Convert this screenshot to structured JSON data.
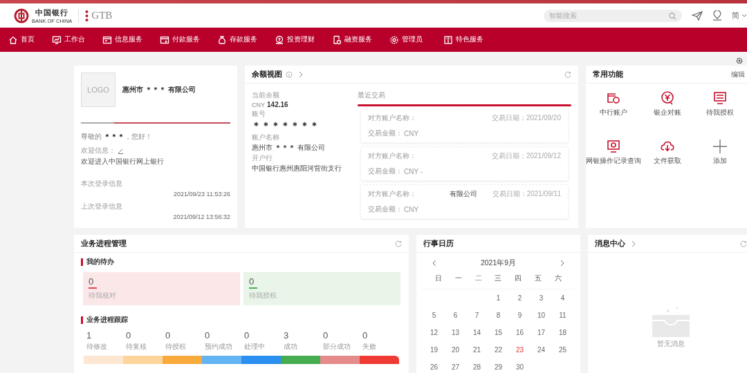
{
  "header": {
    "bank_name": "中国银行",
    "bank_name_en": "BANK OF CHINA",
    "product": "GTB",
    "search": {
      "placeholder": "智能搜索"
    },
    "language": "简"
  },
  "nav": [
    {
      "label": "首页"
    },
    {
      "label": "工作台"
    },
    {
      "label": "信息服务"
    },
    {
      "label": "付款服务"
    },
    {
      "label": "存款服务"
    },
    {
      "label": "投资理财"
    },
    {
      "label": "融资服务"
    },
    {
      "label": "管理员"
    },
    {
      "label": "特色服务"
    }
  ],
  "profile": {
    "logo": "LOGO",
    "company": "惠州市 ＊＊＊ 有限公司",
    "greeting": "尊敬的 **＊＊＊**，您好！",
    "welcome_label": "欢迎信息：",
    "welcome_text": "欢迎进入中国银行网上银行",
    "this_login_label": "本次登录信息",
    "this_login": "2021/09/23 11:53:26",
    "last_login_label": "上次登录信息",
    "last_login": "2021/09/12 13:56:32"
  },
  "balance": {
    "title": "余额视图",
    "current_label": "当前余额",
    "currency": "CNY",
    "amount": "142.16",
    "account_label": "账号",
    "account": "＊＊＊＊＊＊＊",
    "name_label": "账户名称",
    "name": "惠州市 **＊＊＊** 有限公司",
    "bank_label": "开户行",
    "bank": "中国银行惠州惠阳河背街支行",
    "recent_label": "最近交易",
    "transactions": [
      {
        "party_label": "对方账户名称：",
        "amount_label": "交易金额：",
        "amount": "CNY",
        "date": "交易日期：2021/09/20"
      },
      {
        "party_label": "对方账户名称：",
        "amount_label": "交易金额：",
        "amount": "CNY -",
        "date": "交易日期：2021/09/12"
      },
      {
        "party_label": "对方账户名称：",
        "party": "有限公司",
        "amount_label": "交易金额：",
        "amount": "CNY",
        "date": "交易日期：2021/09/11"
      }
    ]
  },
  "shortcuts": {
    "title": "常用功能",
    "edit": "编辑",
    "items": [
      {
        "label": "中行账户"
      },
      {
        "label": "银企对账"
      },
      {
        "label": "待我授权"
      },
      {
        "label": "网银操作记录查询"
      },
      {
        "label": "文件获取"
      },
      {
        "label": "添加"
      }
    ]
  },
  "process": {
    "title": "业务进程管理",
    "todo_title": "我的待办",
    "todos": [
      {
        "count": "0",
        "label": "待我核对",
        "color": "#e0454f"
      },
      {
        "count": "0",
        "label": "待我授权",
        "color": "#4caf50"
      }
    ],
    "tracking_title": "业务进程跟踪",
    "stats": [
      {
        "count": "1",
        "label": "待修改",
        "color": "#fde7d2"
      },
      {
        "count": "0",
        "label": "待复核",
        "color": "#fdd59a"
      },
      {
        "count": "0",
        "label": "待授权",
        "color": "#f9aa3c"
      },
      {
        "count": "0",
        "label": "预约成功",
        "color": "#62b4f3"
      },
      {
        "count": "0",
        "label": "处理中",
        "color": "#2b8ff0"
      },
      {
        "count": "3",
        "label": "成功",
        "color": "#45ad4f"
      },
      {
        "count": "0",
        "label": "部分成功",
        "color": "#e58b8b"
      },
      {
        "count": "0",
        "label": "失败",
        "color": "#ef3b33"
      }
    ]
  },
  "calendar": {
    "title": "行事日历",
    "month": "2021年9月",
    "weekdays": [
      "日",
      "一",
      "二",
      "三",
      "四",
      "五",
      "六"
    ],
    "weeks": [
      [
        {
          "day": "1",
          "selected": false
        },
        {
          "day": "2",
          "selected": false
        },
        {
          "day": "3",
          "selected": false
        },
        {
          "day": "4",
          "selected": false
        }
      ],
      [
        {
          "day": "5",
          "selected": false
        },
        {
          "day": "6",
          "selected": false
        },
        {
          "day": "7",
          "selected": false
        },
        {
          "day": "8",
          "selected": false
        },
        {
          "day": "9",
          "selected": false
        },
        {
          "day": "10",
          "selected": false
        },
        {
          "day": "11",
          "selected": false
        }
      ],
      [
        {
          "day": "12",
          "selected": false
        },
        {
          "day": "13",
          "selected": false
        },
        {
          "day": "14",
          "selected": false
        },
        {
          "day": "15",
          "selected": false
        },
        {
          "day": "16",
          "selected": false
        },
        {
          "day": "17",
          "selected": false
        },
        {
          "day": "18",
          "selected": false
        }
      ],
      [
        {
          "day": "19",
          "selected": false
        },
        {
          "day": "20",
          "selected": false
        },
        {
          "day": "21",
          "selected": false
        },
        {
          "day": "22",
          "selected": false
        },
        {
          "day": "23",
          "selected": true
        },
        {
          "day": "24",
          "selected": false
        },
        {
          "day": "25",
          "selected": false
        }
      ],
      [
        {
          "day": "26",
          "selected": false
        },
        {
          "day": "27",
          "selected": false
        },
        {
          "day": "28",
          "selected": false
        },
        {
          "day": "29",
          "selected": false
        },
        {
          "day": "30",
          "selected": false
        }
      ]
    ]
  },
  "messages": {
    "title": "消息中心",
    "empty": "暂无消息"
  }
}
